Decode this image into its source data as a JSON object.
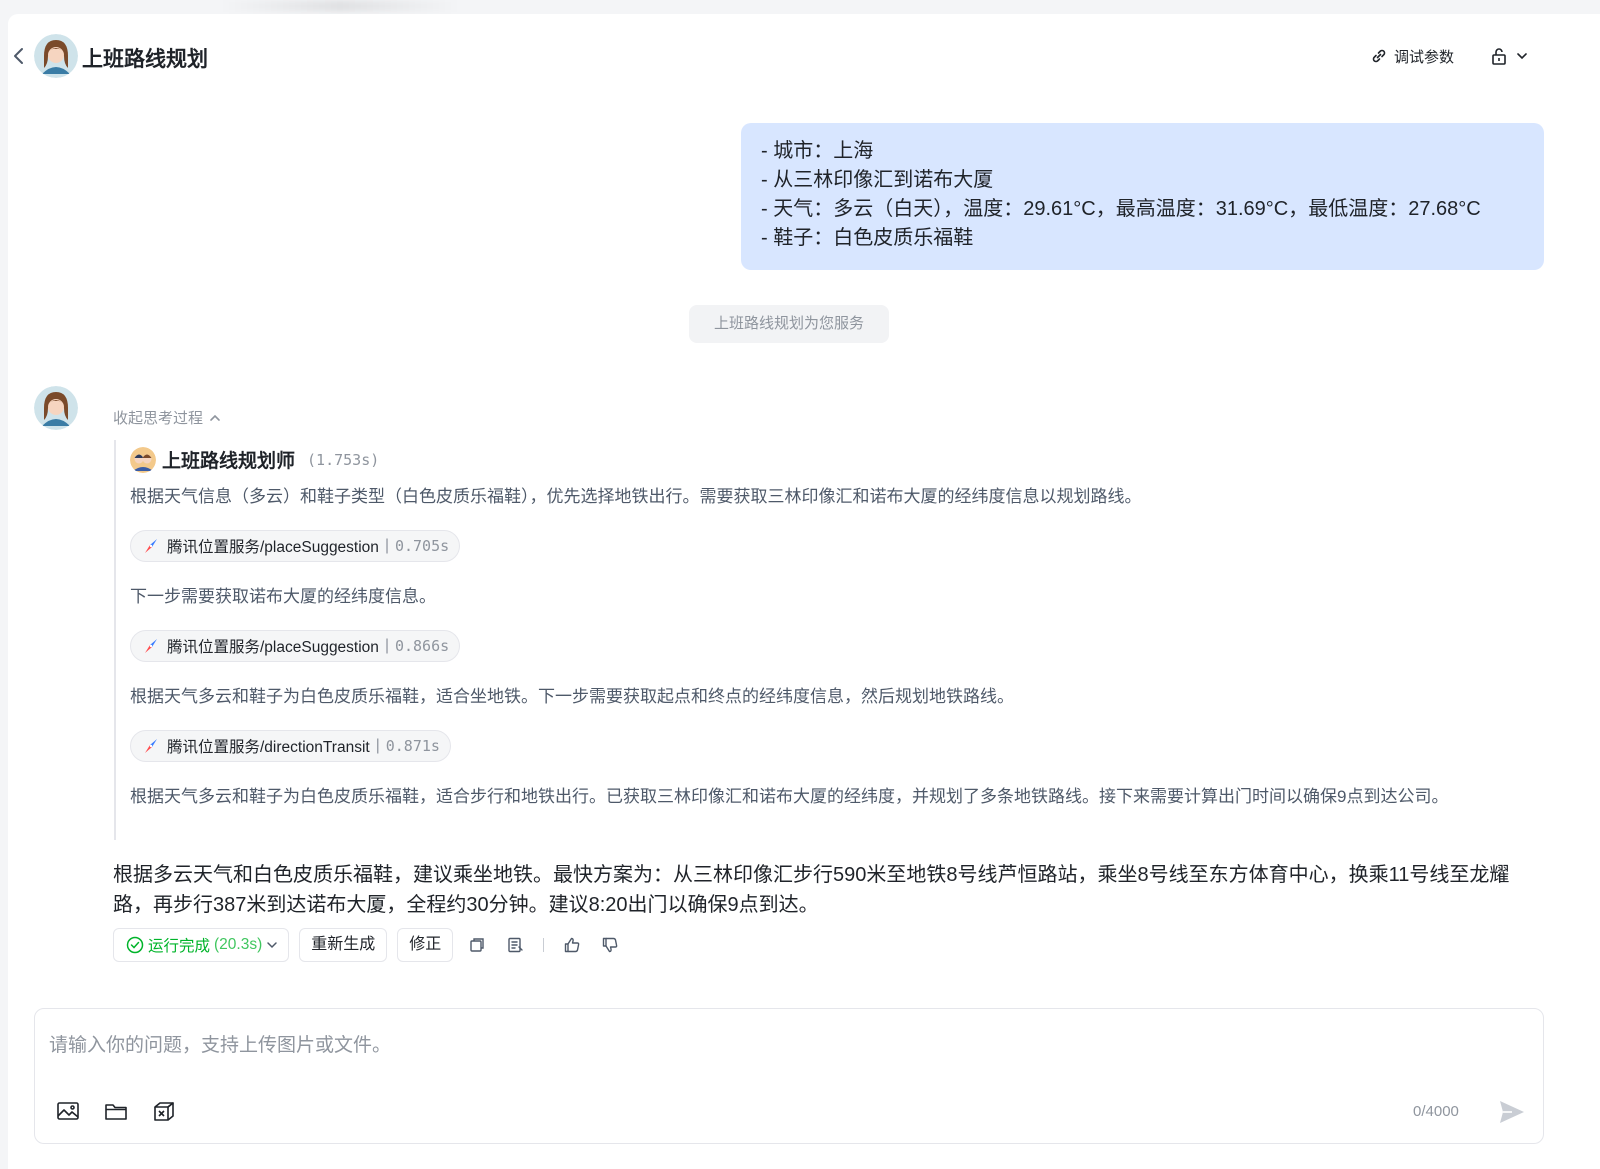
{
  "header": {
    "title": "上班路线规划",
    "debug_label": "调试参数",
    "icons": [
      "chevron-left-icon",
      "debug-link-icon",
      "lock-icon",
      "chevron-down-icon"
    ]
  },
  "user_message": {
    "lines": [
      "- 城市：上海",
      "- 从三林印像汇到诺布大厦",
      "- 天气：多云（白天），温度：29.61°C，最高温度：31.69°C，最低温度：27.68°C",
      "- 鞋子：白色皮质乐福鞋"
    ]
  },
  "service_notice": "上班路线规划为您服务",
  "thinking": {
    "collapse_label": "收起思考过程",
    "agent_name": "上班路线规划师",
    "agent_time": "(1.753s)",
    "steps": [
      {
        "text": "根据天气信息（多云）和鞋子类型（白色皮质乐福鞋），优先选择地铁出行。需要获取三林印像汇和诺布大厦的经纬度信息以规划路线。",
        "tool": "腾讯位置服务/placeSuggestion",
        "duration": "0.705s"
      },
      {
        "text": "下一步需要获取诺布大厦的经纬度信息。",
        "tool": "腾讯位置服务/placeSuggestion",
        "duration": "0.866s"
      },
      {
        "text": "根据天气多云和鞋子为白色皮质乐福鞋，适合坐地铁。下一步需要获取起点和终点的经纬度信息，然后规划地铁路线。",
        "tool": "腾讯位置服务/directionTransit",
        "duration": "0.871s"
      }
    ],
    "final_thought": "根据天气多云和鞋子为白色皮质乐福鞋，适合步行和地铁出行。已获取三林印像汇和诺布大厦的经纬度，并规划了多条地铁路线。接下来需要计算出门时间以确保9点到达公司。"
  },
  "answer": "根据多云天气和白色皮质乐福鞋，建议乘坐地铁。最快方案为：从三林印像汇步行590米至地铁8号线芦恒路站，乘坐8号线至东方体育中心，换乘11号线至龙耀路，再步行387米到达诺布大厦，全程约30分钟。建议8:20出门以确保9点到达。",
  "actions": {
    "status_label": "运行完成",
    "status_duration": "(20.3s)",
    "regenerate_label": "重新生成",
    "fix_label": "修正",
    "icons": [
      "copy-icon",
      "note-icon",
      "thumbs-up-icon",
      "thumbs-down-icon"
    ]
  },
  "input": {
    "placeholder": "请输入你的问题，支持上传图片或文件。",
    "value": "",
    "char_count": "0/4000",
    "icons": [
      "image-upload-icon",
      "folder-icon",
      "plugin-box-icon",
      "send-icon"
    ]
  },
  "colors": {
    "user_bubble": "#d8e6ff",
    "success": "#00b42a",
    "muted_text": "#8f959e",
    "body_text": "#1f2329"
  }
}
